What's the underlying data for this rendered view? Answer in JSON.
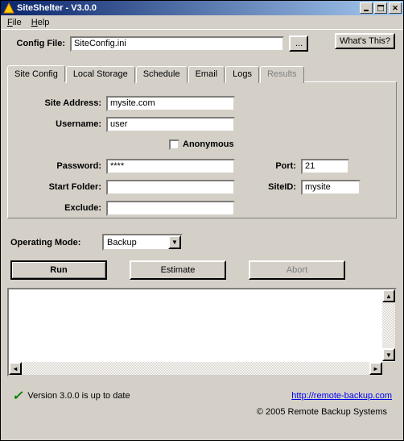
{
  "title": "SiteShelter - V3.0.0",
  "menu": {
    "file": "File",
    "help": "Help"
  },
  "whats_this": "What's This?",
  "config": {
    "label": "Config File:",
    "value": "SiteConfig.ini",
    "browse": "..."
  },
  "tabs": {
    "site_config": "Site Config",
    "local_storage": "Local Storage",
    "schedule": "Schedule",
    "email": "Email",
    "logs": "Logs",
    "results": "Results"
  },
  "form": {
    "site_address_label": "Site Address:",
    "site_address_value": "mysite.com",
    "username_label": "Username:",
    "username_value": "user",
    "anonymous_label": "Anonymous",
    "password_label": "Password:",
    "password_value": "****",
    "port_label": "Port:",
    "port_value": "21",
    "start_folder_label": "Start Folder:",
    "start_folder_value": "",
    "siteid_label": "SiteID:",
    "siteid_value": "mysite",
    "exclude_label": "Exclude:",
    "exclude_value": ""
  },
  "op_mode": {
    "label": "Operating Mode:",
    "value": "Backup"
  },
  "buttons": {
    "run": "Run",
    "estimate": "Estimate",
    "abort": "Abort"
  },
  "footer": {
    "version": "Version 3.0.0 is up to date",
    "link": "http://remote-backup.com",
    "copyright": "© 2005 Remote Backup Systems"
  }
}
